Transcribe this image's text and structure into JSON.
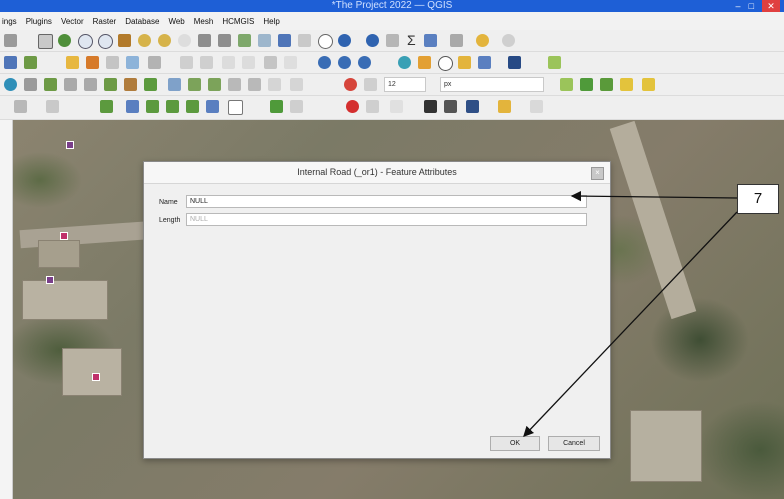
{
  "window": {
    "title": "*The Project 2022 — QGIS"
  },
  "menu": [
    "ings",
    "Plugins",
    "Vector",
    "Raster",
    "Database",
    "Web",
    "Mesh",
    "HCMGIS",
    "Help"
  ],
  "style_toolbar": {
    "font_size": "12",
    "unit": "px"
  },
  "dialog": {
    "title": "Internal Road (_or1) - Feature Attributes",
    "fields": [
      {
        "label": "Name",
        "value": "NULL"
      },
      {
        "label": "Length",
        "value": "NULL"
      }
    ],
    "ok_label": "OK",
    "cancel_label": "Cancel"
  },
  "annotation": {
    "label": "7"
  }
}
